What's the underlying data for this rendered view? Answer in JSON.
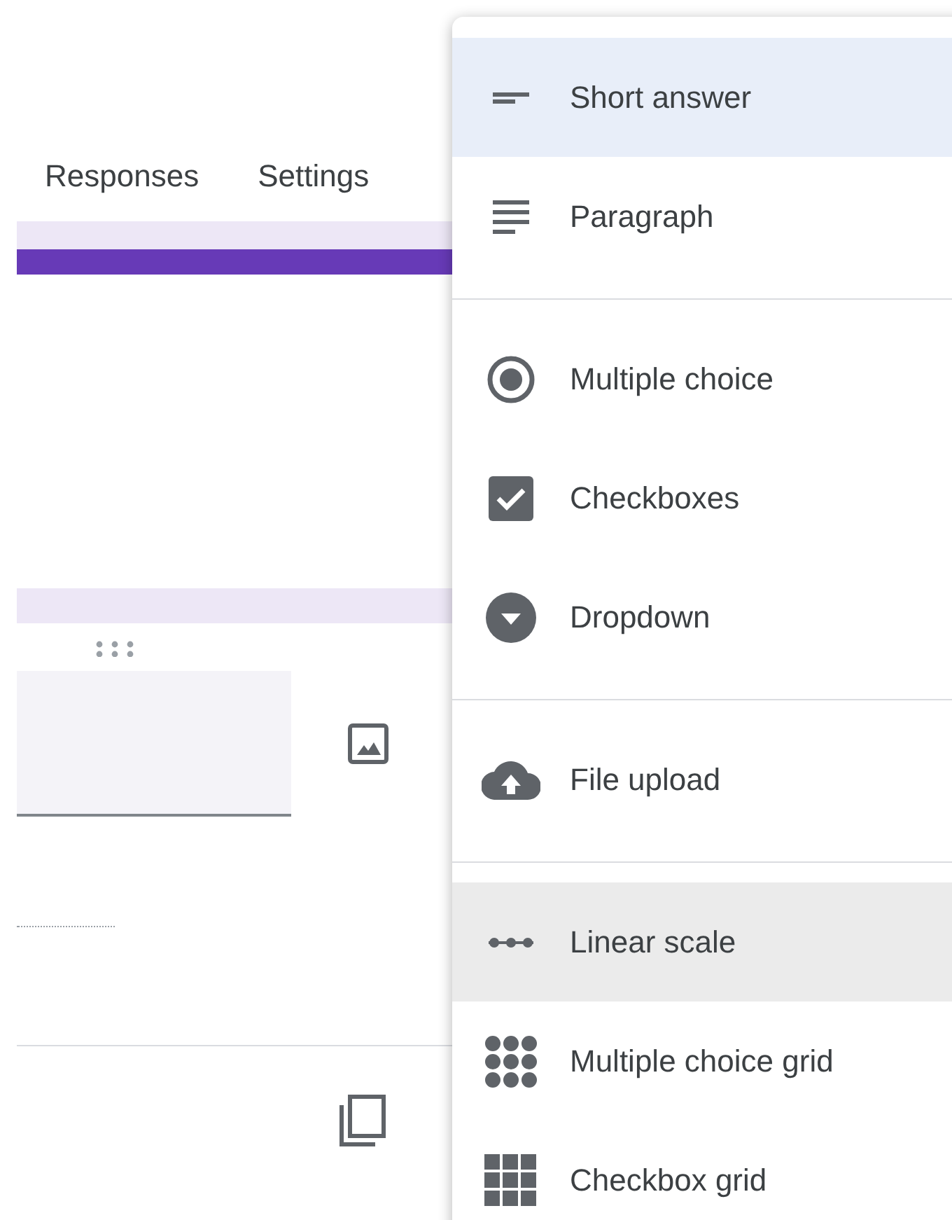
{
  "tabs": [
    {
      "label": "Responses",
      "selected": false
    },
    {
      "label": "Settings",
      "selected": false
    }
  ],
  "menu": {
    "groups": [
      {
        "items": [
          {
            "label": "Short answer",
            "selected": true,
            "hovered": false
          },
          {
            "label": "Paragraph",
            "selected": false,
            "hovered": false
          }
        ]
      },
      {
        "items": [
          {
            "label": "Multiple choice",
            "selected": false,
            "hovered": false
          },
          {
            "label": "Checkboxes",
            "selected": false,
            "hovered": false
          },
          {
            "label": "Dropdown",
            "selected": false,
            "hovered": false
          }
        ]
      },
      {
        "items": [
          {
            "label": "File upload",
            "selected": false,
            "hovered": false
          }
        ]
      },
      {
        "items": [
          {
            "label": "Linear scale",
            "selected": false,
            "hovered": true
          },
          {
            "label": "Multiple choice grid",
            "selected": false,
            "hovered": false
          },
          {
            "label": "Checkbox grid",
            "selected": false,
            "hovered": false
          }
        ]
      }
    ]
  }
}
